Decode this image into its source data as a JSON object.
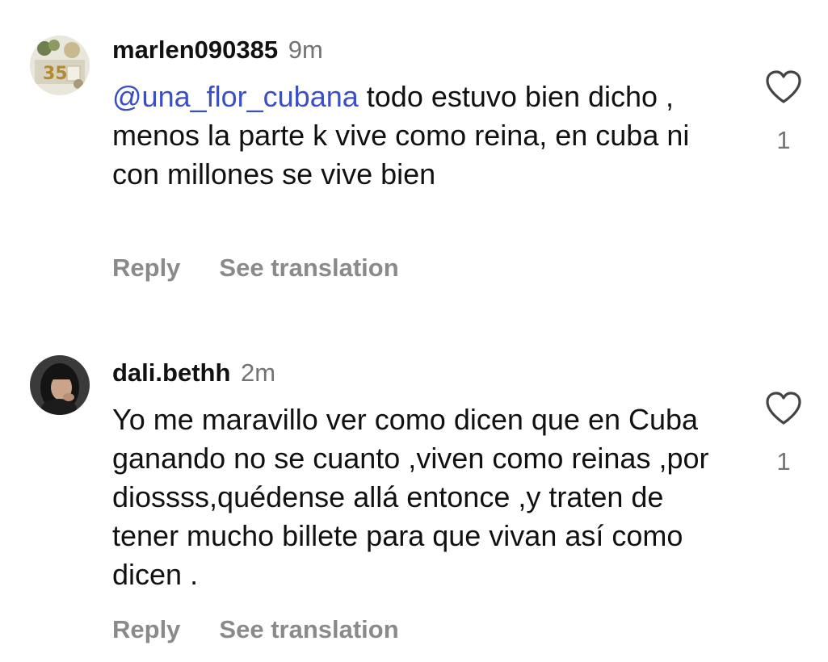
{
  "comments": [
    {
      "username": "marlen090385",
      "time": "9m",
      "mention": "@una_flor_cubana",
      "text": " todo estuvo bien dicho , menos la parte k vive como reina, en cuba ni con millones se vive bien",
      "like_count": "1",
      "reply_label": "Reply",
      "translate_label": "See translation",
      "like_icon": "heart-outline-icon"
    },
    {
      "username": "dali.bethh",
      "time": "2m",
      "text": "Yo me maravillo ver como dicen que en Cuba ganando no se cuanto ,viven como reinas ,por diossss,quédense allá entonce ,y traten de tener mucho billete para que vivan así como dicen .",
      "like_count": "1",
      "reply_label": "Reply",
      "translate_label": "See translation",
      "like_icon": "heart-outline-icon"
    }
  ],
  "colors": {
    "mention": "#3b4fc4",
    "secondary_text": "#737373",
    "action_text": "#8a8a8a",
    "primary_text": "#111111"
  }
}
